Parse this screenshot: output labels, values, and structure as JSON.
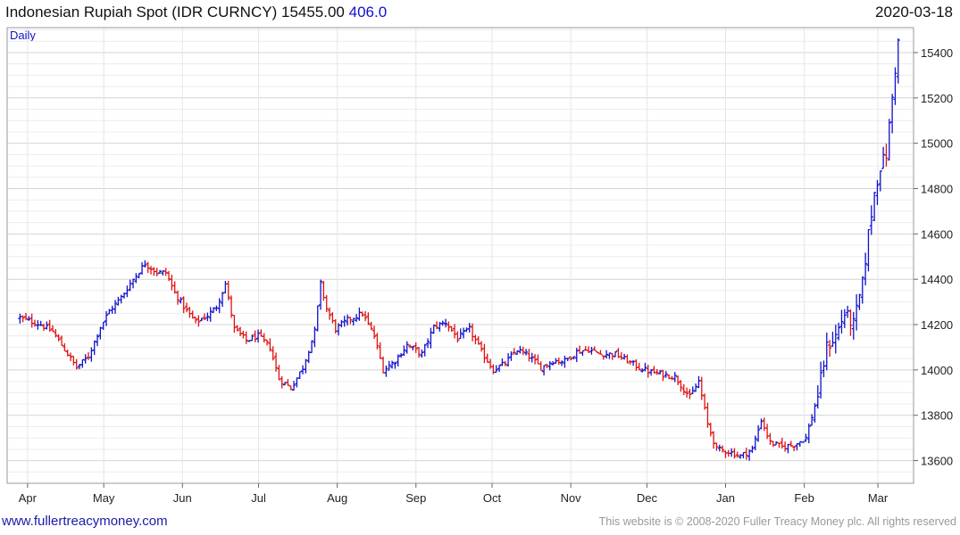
{
  "header": {
    "title": "Indonesian Rupiah Spot (IDR CURNCY)",
    "price": "15455.00",
    "change": "406.0",
    "date": "2020-03-18",
    "period": "Daily"
  },
  "footer": {
    "site": "www.fullertreacymoney.com",
    "copyright": "This website is © 2008-2020 Fuller Treacy Money plc. All rights reserved"
  },
  "colors": {
    "up": "#1010cc",
    "down": "#e01010",
    "grid": "#d4d4d4",
    "frame": "#999999"
  },
  "chart_data": {
    "type": "ohlc",
    "ylim": [
      13500,
      15510
    ],
    "y_ticks": [
      13600,
      13800,
      14000,
      14200,
      14400,
      14600,
      14800,
      15000,
      15200,
      15400
    ],
    "x_labels": [
      "Apr",
      "May",
      "Jun",
      "Jul",
      "Aug",
      "Sep",
      "Oct",
      "Nov",
      "Dec",
      "Jan",
      "Feb",
      "Mar"
    ],
    "x_label_days": [
      7,
      37,
      68,
      98,
      129,
      160,
      190,
      221,
      251,
      282,
      313,
      342
    ],
    "x_range_days": [
      0,
      355
    ],
    "day_origin": "2019-03-25",
    "grid": true,
    "closes": [
      [
        0,
        14230
      ],
      [
        7,
        14200
      ],
      [
        11,
        14170
      ],
      [
        15,
        14090
      ],
      [
        19,
        14010
      ],
      [
        23,
        14060
      ],
      [
        27,
        14190
      ],
      [
        30,
        14260
      ],
      [
        34,
        14320
      ],
      [
        38,
        14400
      ],
      [
        42,
        14470
      ],
      [
        46,
        14430
      ],
      [
        49,
        14430
      ],
      [
        52,
        14340
      ],
      [
        56,
        14260
      ],
      [
        59,
        14210
      ],
      [
        63,
        14240
      ],
      [
        66,
        14280
      ],
      [
        69,
        14380
      ],
      [
        72,
        14180
      ],
      [
        76,
        14130
      ],
      [
        80,
        14150
      ],
      [
        84,
        14100
      ],
      [
        87,
        13960
      ],
      [
        91,
        13920
      ],
      [
        95,
        14010
      ],
      [
        99,
        14170
      ],
      [
        101,
        14380
      ],
      [
        103,
        14270
      ],
      [
        106,
        14180
      ],
      [
        110,
        14220
      ],
      [
        115,
        14250
      ],
      [
        119,
        14150
      ],
      [
        122,
        14000
      ],
      [
        126,
        14040
      ],
      [
        130,
        14110
      ],
      [
        135,
        14070
      ],
      [
        139,
        14190
      ],
      [
        143,
        14210
      ],
      [
        147,
        14140
      ],
      [
        151,
        14180
      ],
      [
        155,
        14080
      ],
      [
        159,
        14000
      ],
      [
        163,
        14030
      ],
      [
        167,
        14090
      ],
      [
        171,
        14060
      ],
      [
        175,
        14010
      ],
      [
        179,
        14040
      ],
      [
        183,
        14040
      ],
      [
        187,
        14080
      ],
      [
        191,
        14090
      ],
      [
        195,
        14070
      ],
      [
        200,
        14070
      ],
      [
        204,
        14040
      ],
      [
        208,
        14010
      ],
      [
        212,
        13990
      ],
      [
        216,
        13980
      ],
      [
        220,
        13970
      ],
      [
        225,
        13880
      ],
      [
        228,
        13950
      ],
      [
        231,
        13760
      ],
      [
        234,
        13650
      ],
      [
        238,
        13640
      ],
      [
        242,
        13620
      ],
      [
        246,
        13650
      ],
      [
        249,
        13780
      ],
      [
        252,
        13680
      ],
      [
        256,
        13660
      ],
      [
        260,
        13670
      ],
      [
        264,
        13700
      ],
      [
        268,
        13890
      ],
      [
        271,
        14100
      ],
      [
        274,
        14150
      ],
      [
        277,
        14250
      ],
      [
        280,
        14200
      ],
      [
        283,
        14380
      ],
      [
        285,
        14600
      ],
      [
        287,
        14780
      ],
      [
        289,
        14900
      ],
      [
        291,
        14950
      ],
      [
        293,
        15200
      ],
      [
        295,
        15455
      ]
    ]
  }
}
